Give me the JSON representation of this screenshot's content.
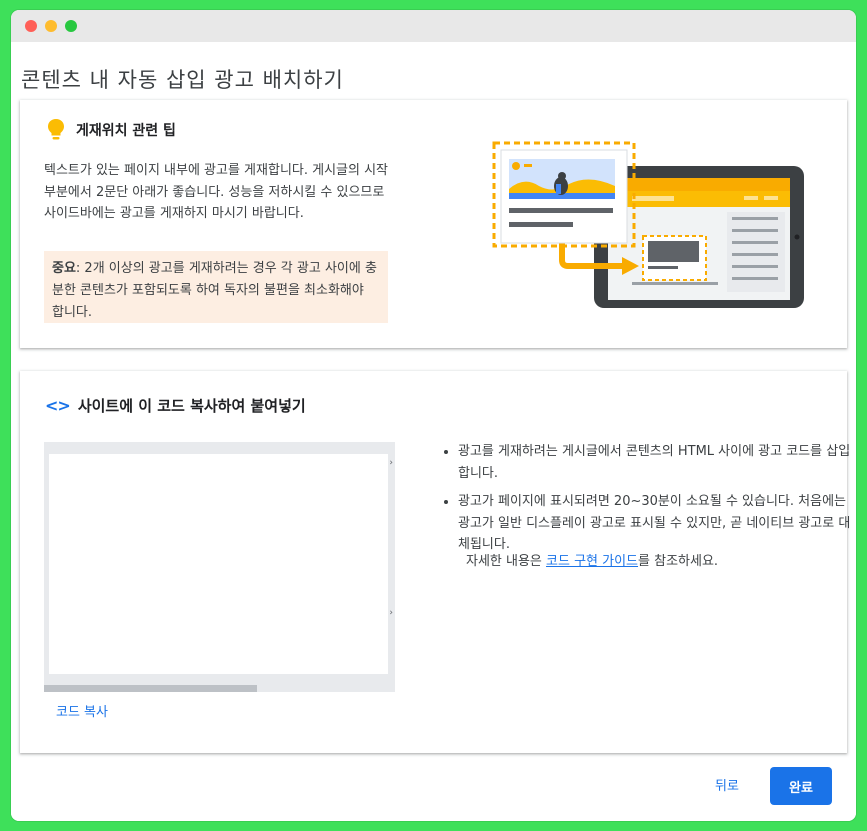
{
  "page": {
    "title": "콘텐츠 내 자동 삽입 광고 배치하기"
  },
  "tip": {
    "icon": "lightbulb-icon",
    "icon_color": "#fbbc04",
    "title": "게재위치 관련 팁",
    "body": "텍스트가 있는 페이지 내부에 광고를 게재합니다. 게시글의 시작 부분에서 2문단 아래가 좋습니다. 성능을 저하시킬 수 있으므로 사이드바에는 광고를 게재하지 마시기 바랍니다.",
    "note_label": "중요",
    "note_text": ": 2개 이상의 광고를 게재하려는 경우 각 광고 사이에 충분한 콘텐츠가 포함되도록 하여 독자의 불편을 최소화해야 합니다.",
    "note_bg": "#fdeee2"
  },
  "code_section": {
    "icon": "code-icon",
    "icon_glyph": "<>",
    "title": "사이트에 이 코드 복사하여 붙여넣기",
    "copy_label": "코드 복사",
    "bullets": [
      "광고를 게재하려는 게시글에서 콘텐츠의 HTML 사이에 광고 코드를 삽입합니다.",
      "광고가 페이지에 표시되려면 20~30분이 소요될 수 있습니다. 처음에는 광고가 일반 디스플레이 광고로 표시될 수 있지만, 곧 네이티브 광고로 대체됩니다."
    ],
    "more_prefix": "자세한 내용은 ",
    "more_link": "코드 구현 가이드",
    "more_suffix": "를 참조하세요."
  },
  "footer": {
    "back_label": "뒤로",
    "done_label": "완료"
  },
  "colors": {
    "accent": "#1a73e8",
    "background": "#3ee05a",
    "illustration_orange": "#f9ab00"
  }
}
